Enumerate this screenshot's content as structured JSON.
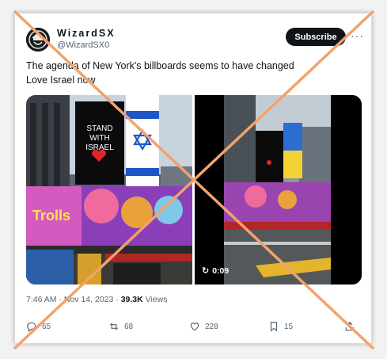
{
  "author": {
    "display_name": "WizardSX",
    "handle": "@WizardSX0",
    "avatar_icon": "wizard-avatar-icon"
  },
  "header": {
    "subscribe_label": "Subscribe",
    "more_icon": "more-dots-icon"
  },
  "tweet": {
    "lines": [
      "The agenda of New York's billboards seems to have changed",
      "Love Israel now"
    ]
  },
  "media": {
    "left_image": {
      "billboard_text": [
        "STAND",
        "WITH",
        "ISRAEL"
      ],
      "banner_text": "Trolls"
    },
    "right_video": {
      "duration": "0:09",
      "replay_icon": "replay-icon"
    }
  },
  "meta": {
    "time": "7:46 AM",
    "separator": " · ",
    "date": "Nov 14, 2023",
    "views_count": "39.3K",
    "views_label": "Views"
  },
  "actions": {
    "replies": "65",
    "reposts": "68",
    "likes": "228",
    "bookmarks": "15"
  },
  "overlay": {
    "cross_color": "#f2a26b"
  },
  "colors": {
    "subscribe_bg": "#0f1419",
    "muted": "#536471",
    "israel_blue": "#1f56c4",
    "ukraine_blue": "#2a6fd1",
    "ukraine_yellow": "#f5d233"
  }
}
